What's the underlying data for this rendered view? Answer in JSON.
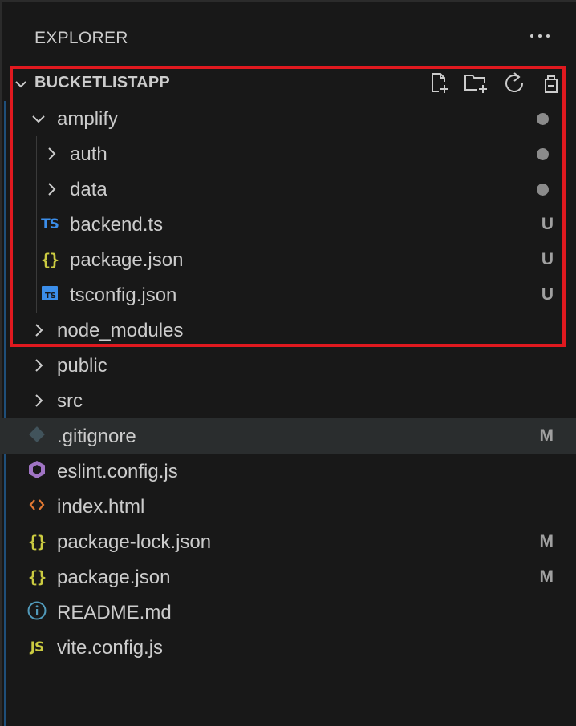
{
  "explorer": {
    "title": "EXPLORER",
    "more_icon": "ellipsis-icon"
  },
  "section": {
    "label": "BUCKETLISTAPP",
    "actions": [
      {
        "icon": "new-file-icon"
      },
      {
        "icon": "new-folder-icon"
      },
      {
        "icon": "refresh-icon"
      },
      {
        "icon": "collapse-all-icon"
      }
    ]
  },
  "tree": [
    {
      "label": "amplify",
      "type": "folder",
      "expanded": true,
      "indent": 0,
      "status": "dot"
    },
    {
      "label": "auth",
      "type": "folder",
      "expanded": false,
      "indent": 1,
      "status": "dot"
    },
    {
      "label": "data",
      "type": "folder",
      "expanded": false,
      "indent": 1,
      "status": "dot"
    },
    {
      "label": "backend.ts",
      "type": "ts",
      "indent": 1,
      "status": "U"
    },
    {
      "label": "package.json",
      "type": "json",
      "indent": 1,
      "status": "U"
    },
    {
      "label": "tsconfig.json",
      "type": "tsconfig",
      "indent": 1,
      "status": "U"
    },
    {
      "label": "node_modules",
      "type": "folder",
      "expanded": false,
      "indent": 0,
      "status": ""
    },
    {
      "label": "public",
      "type": "folder",
      "expanded": false,
      "indent": 0,
      "status": ""
    },
    {
      "label": "src",
      "type": "folder",
      "expanded": false,
      "indent": 0,
      "status": ""
    },
    {
      "label": ".gitignore",
      "type": "git",
      "indent": 0,
      "status": "M",
      "highlight": true
    },
    {
      "label": "eslint.config.js",
      "type": "eslint",
      "indent": 0,
      "status": ""
    },
    {
      "label": "index.html",
      "type": "html",
      "indent": 0,
      "status": ""
    },
    {
      "label": "package-lock.json",
      "type": "json",
      "indent": 0,
      "status": "M"
    },
    {
      "label": "package.json",
      "type": "json",
      "indent": 0,
      "status": "M"
    },
    {
      "label": "README.md",
      "type": "info",
      "indent": 0,
      "status": ""
    },
    {
      "label": "vite.config.js",
      "type": "js",
      "indent": 0,
      "status": ""
    }
  ],
  "icon_text": {
    "ts": "TS",
    "js": "JS",
    "json": "{}"
  },
  "colors": {
    "background": "#181818",
    "text": "#cccccc",
    "highlight_row": "#2a2d2e",
    "annotation_box": "#e0191f",
    "ts_icon": "#3b8eea",
    "json_icon": "#cbcb41",
    "html_icon": "#e37933",
    "eslint_icon": "#a074c4",
    "git_icon": "#41535b",
    "info_icon": "#519aba"
  }
}
